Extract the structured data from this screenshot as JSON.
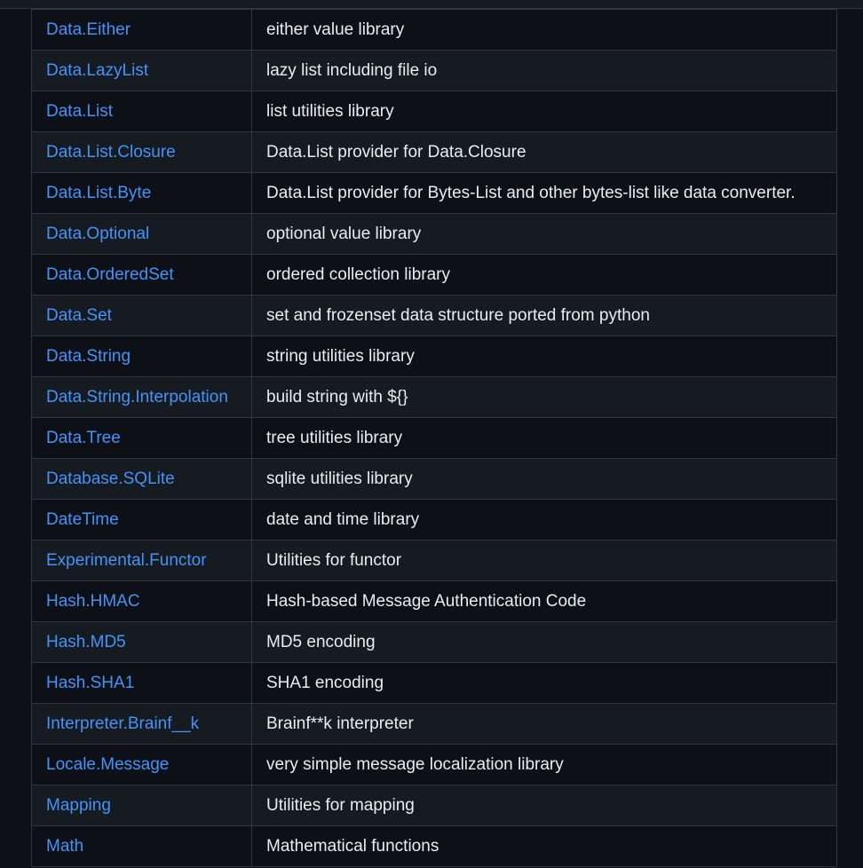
{
  "modules": [
    {
      "name": "Data.Either",
      "description": "either value library"
    },
    {
      "name": "Data.LazyList",
      "description": "lazy list including file io"
    },
    {
      "name": "Data.List",
      "description": "list utilities library"
    },
    {
      "name": "Data.List.Closure",
      "description": "Data.List provider for Data.Closure"
    },
    {
      "name": "Data.List.Byte",
      "description": "Data.List provider for Bytes-List and other bytes-list like data converter."
    },
    {
      "name": "Data.Optional",
      "description": "optional value library"
    },
    {
      "name": "Data.OrderedSet",
      "description": "ordered collection library"
    },
    {
      "name": "Data.Set",
      "description": "set and frozenset data structure ported from python"
    },
    {
      "name": "Data.String",
      "description": "string utilities library"
    },
    {
      "name": "Data.String.Interpolation",
      "description": "build string with ${}"
    },
    {
      "name": "Data.Tree",
      "description": "tree utilities library"
    },
    {
      "name": "Database.SQLite",
      "description": "sqlite utilities library"
    },
    {
      "name": "DateTime",
      "description": "date and time library"
    },
    {
      "name": "Experimental.Functor",
      "description": "Utilities for functor"
    },
    {
      "name": "Hash.HMAC",
      "description": "Hash-based Message Authentication Code"
    },
    {
      "name": "Hash.MD5",
      "description": "MD5 encoding"
    },
    {
      "name": "Hash.SHA1",
      "description": "SHA1 encoding"
    },
    {
      "name": "Interpreter.Brainf__k",
      "description": "Brainf**k interpreter"
    },
    {
      "name": "Locale.Message",
      "description": "very simple message localization library"
    },
    {
      "name": "Mapping",
      "description": "Utilities for mapping"
    },
    {
      "name": "Math",
      "description": "Mathematical functions"
    }
  ]
}
